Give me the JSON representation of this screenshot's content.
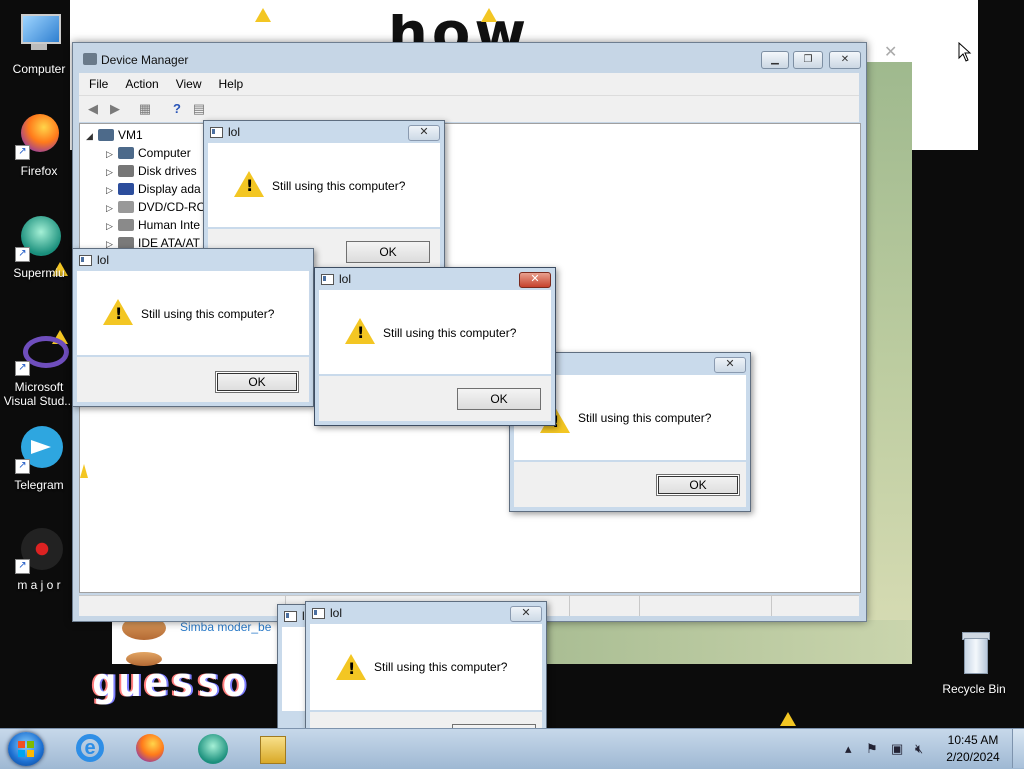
{
  "desktop": {
    "icons": [
      {
        "label": "Computer",
        "icon": "computer-icon"
      },
      {
        "label": "Firefox",
        "icon": "firefox-icon"
      },
      {
        "label": "Supermiu",
        "icon": "supermium-icon"
      },
      {
        "label": "Microsoft Visual Stud...",
        "icon": "visual-studio-icon"
      },
      {
        "label": "Telegram",
        "icon": "telegram-icon"
      },
      {
        "label": "m a j o r",
        "icon": "major-icon"
      }
    ],
    "recycle_bin": "Recycle Bin"
  },
  "background": {
    "big_text": "how",
    "glitch_text": "guesso",
    "chat_name": "Simba moder_be"
  },
  "device_manager": {
    "title": "Device Manager",
    "menu": [
      "File",
      "Action",
      "View",
      "Help"
    ],
    "tree": {
      "root": "VM1",
      "children": [
        "Computer",
        "Disk drives",
        "Display ada",
        "DVD/CD-RO",
        "Human Inte",
        "IDE ATA/AT"
      ]
    }
  },
  "dialogs": [
    {
      "title": "lol",
      "message": "Still using this computer?",
      "ok": "OK"
    },
    {
      "title": "lol",
      "message": "Still using this computer?",
      "ok": "OK"
    },
    {
      "title": "lol",
      "message": "Still using this computer?",
      "ok": "OK"
    },
    {
      "title": "lol",
      "message": "Still using this computer?",
      "ok": "OK"
    },
    {
      "title": "lol",
      "message": "Still using this computer?",
      "ok": "OK"
    },
    {
      "title": "lol"
    }
  ],
  "taskbar": {
    "time": "10:45 AM",
    "date": "2/20/2024",
    "apps": [
      "internet-explorer-icon",
      "firefox-icon",
      "supermium-icon",
      "explorer-icon"
    ]
  },
  "colors": {
    "warning": "#f3c623",
    "taskbar": "#b3c9e0",
    "close_red": "#c6412c"
  }
}
